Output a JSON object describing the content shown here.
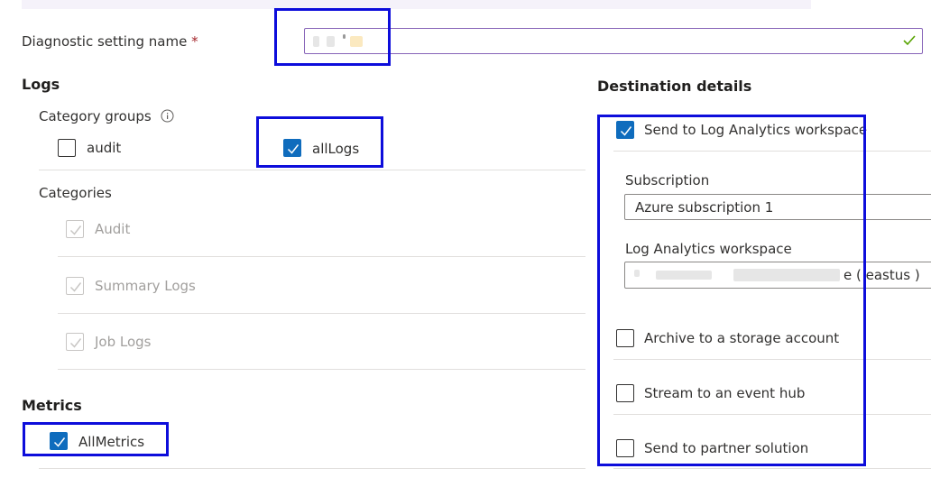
{
  "form": {
    "name_label": "Diagnostic setting name",
    "required_mark": "*"
  },
  "logs": {
    "title": "Logs",
    "category_groups_label": "Category groups",
    "groups": [
      {
        "label": "audit",
        "checked": false
      },
      {
        "label": "allLogs",
        "checked": true
      }
    ],
    "categories_label": "Categories",
    "categories": [
      {
        "label": "Audit",
        "checked": true,
        "disabled": true
      },
      {
        "label": "Summary Logs",
        "checked": true,
        "disabled": true
      },
      {
        "label": "Job Logs",
        "checked": true,
        "disabled": true
      }
    ]
  },
  "metrics": {
    "title": "Metrics",
    "items": [
      {
        "label": "AllMetrics",
        "checked": true
      }
    ]
  },
  "destination": {
    "title": "Destination details",
    "log_analytics_label": "Send to Log Analytics workspace",
    "subscription_label": "Subscription",
    "subscription_value": "Azure subscription 1",
    "workspace_label": "Log Analytics workspace",
    "workspace_value_visible": "e ( eastus )",
    "archive_label": "Archive to a storage account",
    "stream_label": "Stream to an event hub",
    "partner_label": "Send to partner solution"
  },
  "colors": {
    "accent": "#0f6cbd",
    "highlight_box": "#0d0ddb",
    "valid_check": "#57a300",
    "required": "#a4262c"
  }
}
